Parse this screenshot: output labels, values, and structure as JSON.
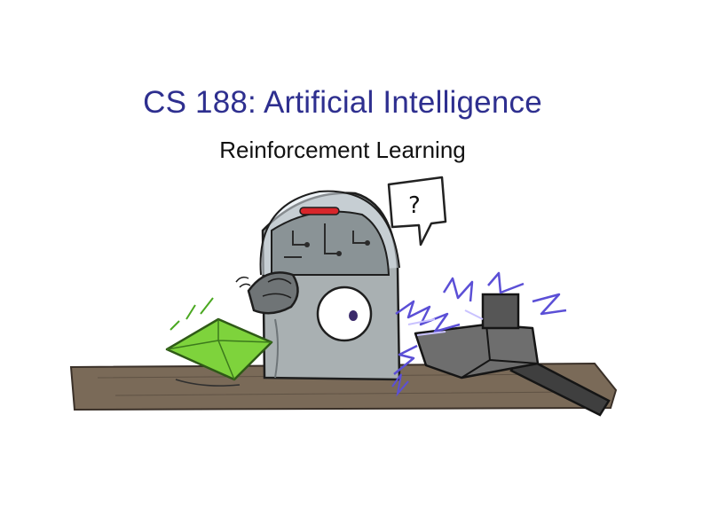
{
  "slide": {
    "title": "CS 188: Artificial Intelligence",
    "subtitle": "Reinforcement Learning",
    "speech_bubble": "?",
    "title_color": "#2e2f8f",
    "illustration": {
      "description_icons": [
        "robot-icon",
        "green-gem-icon",
        "electrified-hammer-icon",
        "speech-bubble-icon"
      ]
    }
  }
}
